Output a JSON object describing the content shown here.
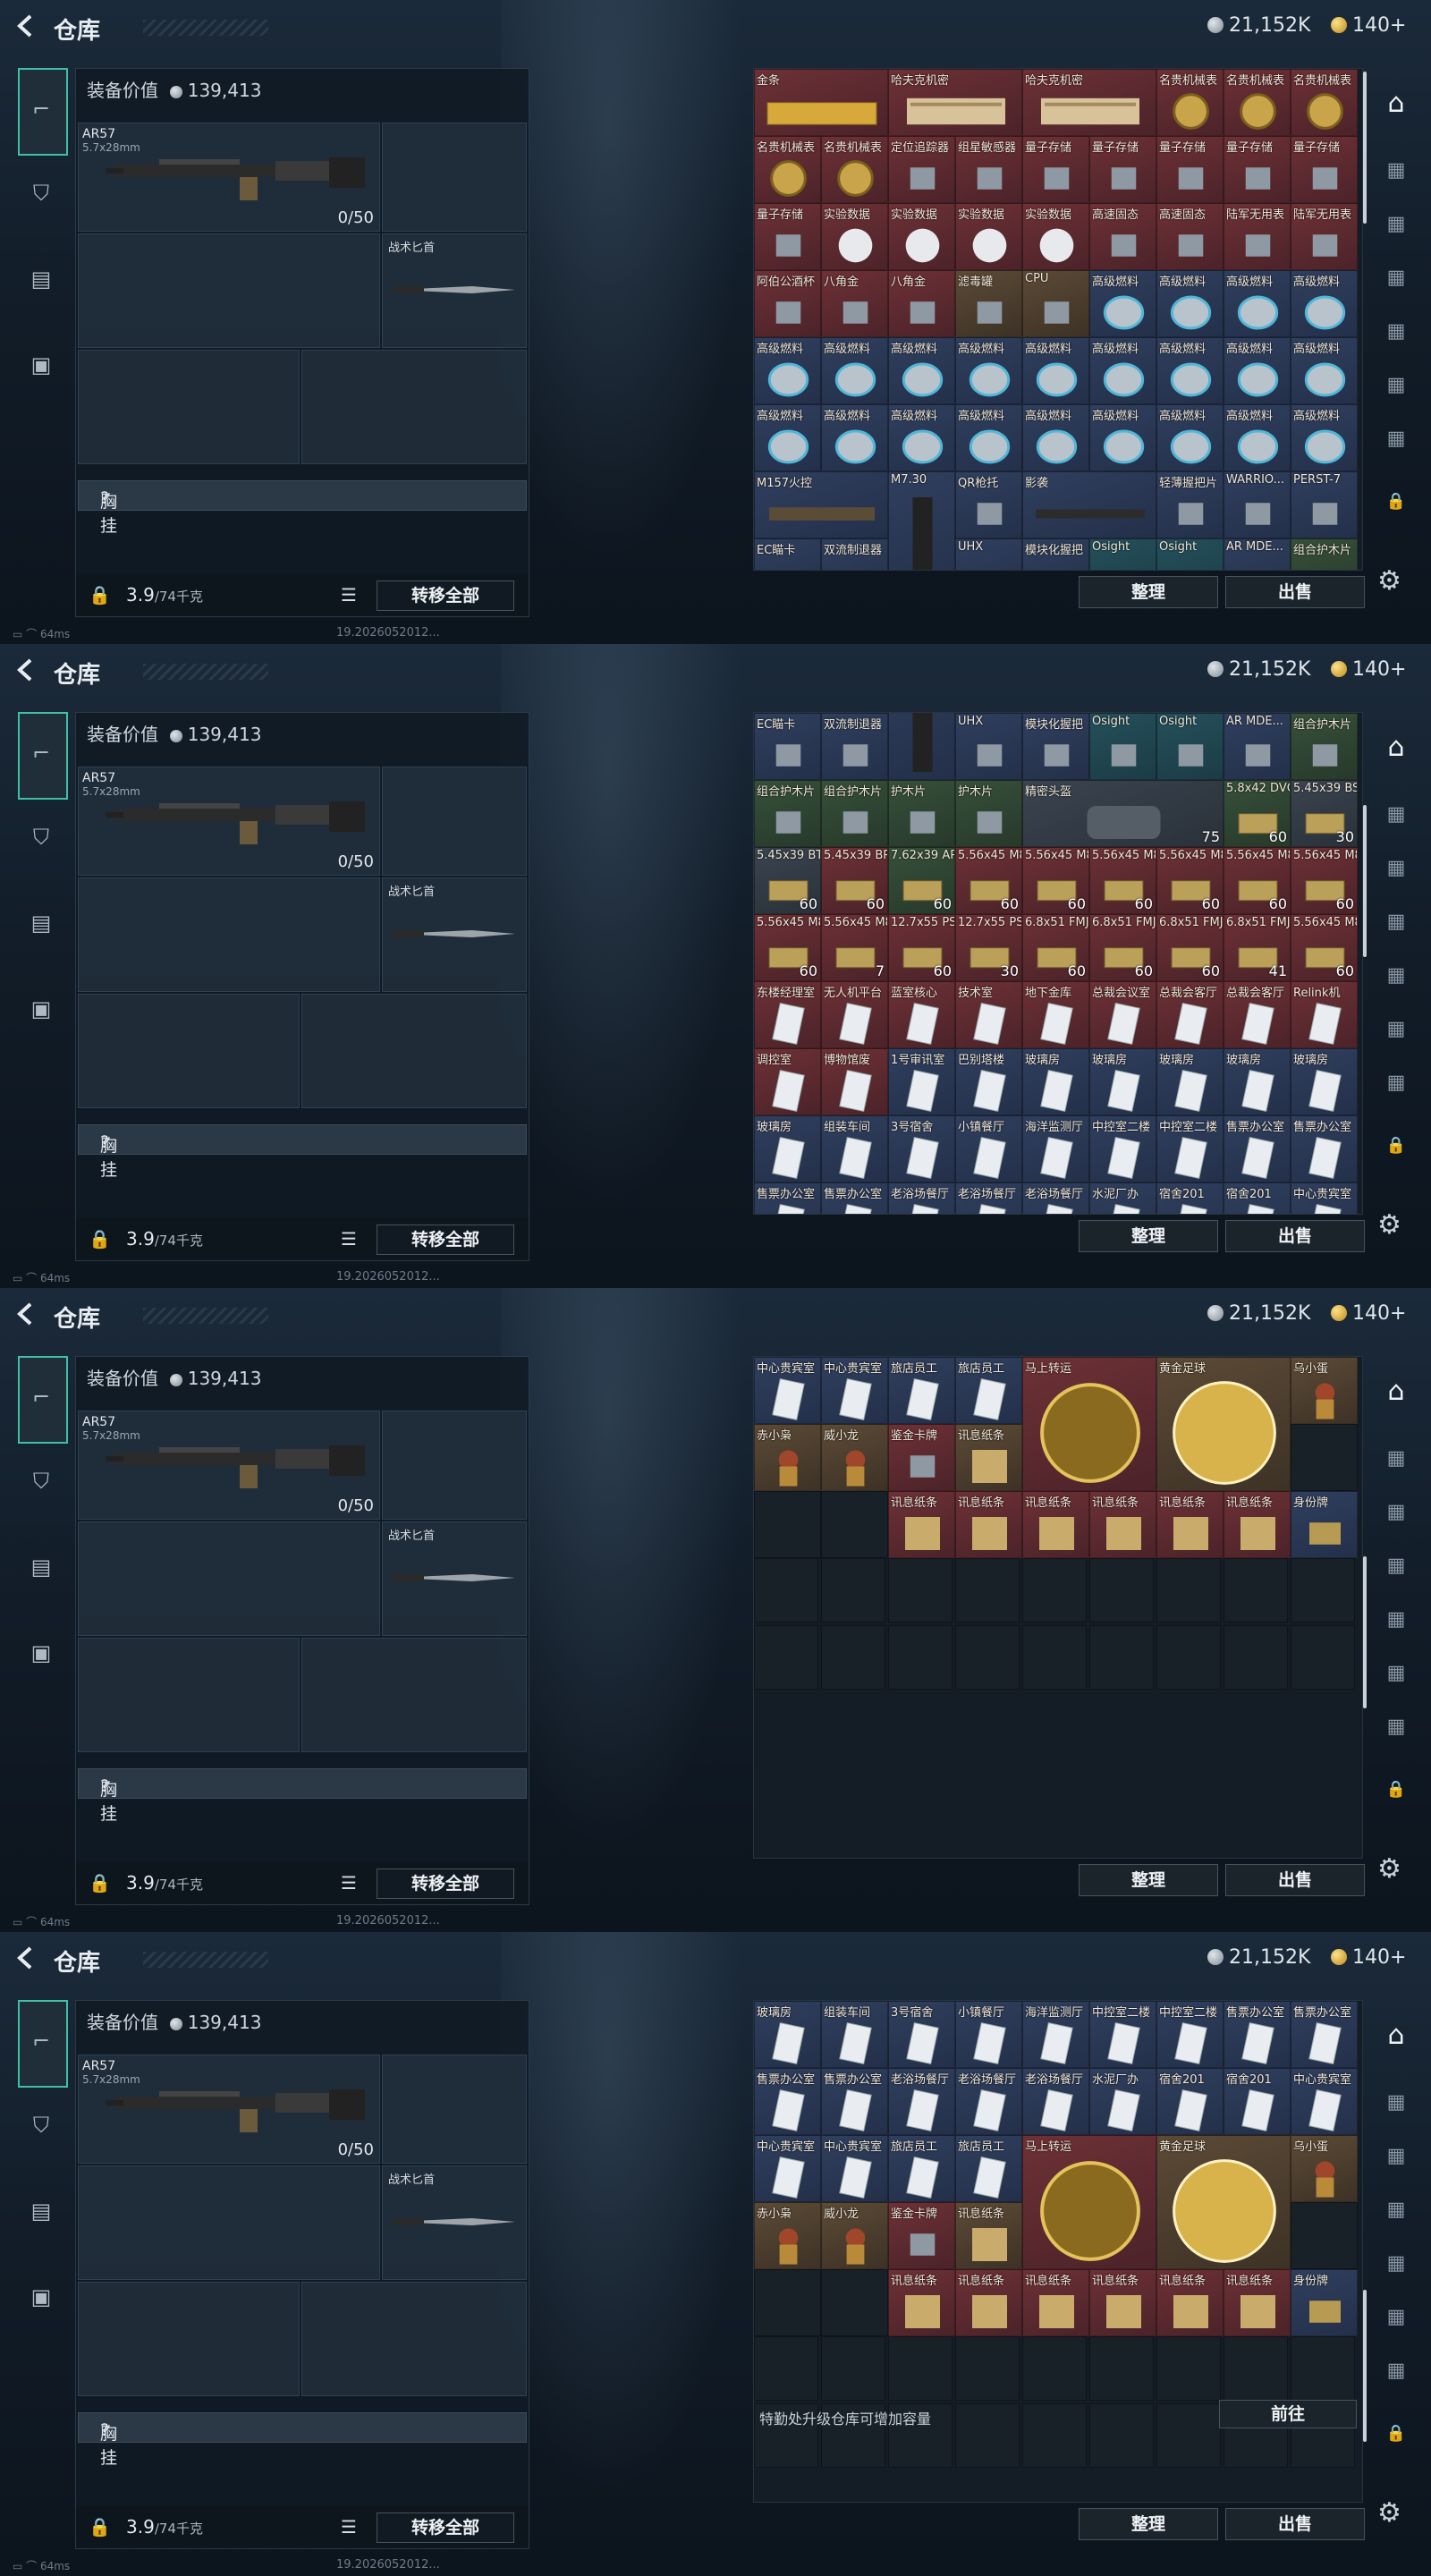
{
  "header": {
    "title": "仓库",
    "silver": "21,152K",
    "gold": "140+"
  },
  "equipment": {
    "value_label": "装备价值",
    "value": "139,413",
    "gun_name": "AR57",
    "gun_caliber": "5.7x28mm",
    "gun_ammo": "0/50",
    "knife_label": "战术匕首",
    "chest_label": "胸挂",
    "chest_help": "?",
    "weight": "3.9",
    "weight_max": "/74千克",
    "transfer_all": "转移全部"
  },
  "storage": {
    "sort": "整理",
    "sell": "出售",
    "upgrade_tip": "特勤处升级仓库可增加容量",
    "upgrade_go": "前往"
  },
  "status": {
    "ping": "64ms",
    "version": "19.2026052012..."
  },
  "colors": {
    "accent": "#3fbfa6",
    "rare_red": "#6d3136",
    "rare_blue": "#2f3f5e",
    "rare_gold": "#5c4a36"
  },
  "items": [
    {
      "n": "金条",
      "c": "red",
      "w": 2,
      "h": 1,
      "icon": "gold-bar-icon"
    },
    {
      "n": "哈夫克机密",
      "c": "red",
      "w": 2,
      "h": 1,
      "icon": "document-icon"
    },
    {
      "n": "哈夫克机密",
      "c": "red",
      "w": 2,
      "h": 1,
      "icon": "document-icon"
    },
    {
      "n": "名贵机械表",
      "c": "red",
      "icon": "watch-icon"
    },
    {
      "n": "名贵机械表",
      "c": "red",
      "icon": "watch-icon"
    },
    {
      "n": "名贵机械表",
      "c": "red",
      "icon": "watch-icon"
    },
    {
      "n": "名贵机械表",
      "c": "red",
      "icon": "watch-icon"
    },
    {
      "n": "名贵机械表",
      "c": "red",
      "icon": "watch-icon"
    },
    {
      "n": "定位追踪器",
      "c": "red",
      "icon": "device-icon"
    },
    {
      "n": "组星敏感器",
      "c": "red",
      "icon": "device-icon"
    },
    {
      "n": "量子存储",
      "c": "red",
      "icon": "chip-icon"
    },
    {
      "n": "量子存储",
      "c": "red",
      "icon": "chip-icon"
    },
    {
      "n": "量子存储",
      "c": "red",
      "icon": "chip-icon"
    },
    {
      "n": "量子存储",
      "c": "red",
      "icon": "chip-icon"
    },
    {
      "n": "量子存储",
      "c": "red",
      "icon": "chip-icon"
    },
    {
      "n": "量子存储",
      "c": "red",
      "icon": "chip-icon"
    },
    {
      "n": "实验数据",
      "c": "red",
      "icon": "disc-icon"
    },
    {
      "n": "实验数据",
      "c": "red",
      "icon": "disc-icon"
    },
    {
      "n": "实验数据",
      "c": "red",
      "icon": "disc-icon"
    },
    {
      "n": "实验数据",
      "c": "red",
      "icon": "disc-icon"
    },
    {
      "n": "高速固态",
      "c": "red",
      "icon": "ssd-icon"
    },
    {
      "n": "高速固态",
      "c": "red",
      "icon": "ssd-icon"
    },
    {
      "n": "陆军无用表",
      "c": "red",
      "icon": "box-icon"
    },
    {
      "n": "陆军无用表",
      "c": "red",
      "icon": "box-icon"
    },
    {
      "n": "阿伯公酒杯",
      "c": "red",
      "icon": "cup-icon"
    },
    {
      "n": "八角金",
      "c": "red",
      "icon": "coin-icon"
    },
    {
      "n": "八角金",
      "c": "red",
      "icon": "coin-icon"
    },
    {
      "n": "滤毒罐",
      "c": "gold",
      "icon": "canister-icon"
    },
    {
      "n": "CPU",
      "c": "gold",
      "icon": "cpu-icon"
    },
    {
      "n": "高级燃料",
      "c": "blue",
      "icon": "fuel-icon"
    },
    {
      "n": "高级燃料",
      "c": "blue",
      "icon": "fuel-icon"
    },
    {
      "n": "高级燃料",
      "c": "blue",
      "icon": "fuel-icon"
    },
    {
      "n": "高级燃料",
      "c": "blue",
      "icon": "fuel-icon"
    },
    {
      "n": "高级燃料",
      "c": "blue",
      "icon": "fuel-icon"
    },
    {
      "n": "高级燃料",
      "c": "blue",
      "icon": "fuel-icon"
    },
    {
      "n": "高级燃料",
      "c": "blue",
      "icon": "fuel-icon"
    },
    {
      "n": "高级燃料",
      "c": "blue",
      "icon": "fuel-icon"
    },
    {
      "n": "高级燃料",
      "c": "blue",
      "icon": "fuel-icon"
    },
    {
      "n": "高级燃料",
      "c": "blue",
      "icon": "fuel-icon"
    },
    {
      "n": "高级燃料",
      "c": "blue",
      "icon": "fuel-icon"
    },
    {
      "n": "高级燃料",
      "c": "blue",
      "icon": "fuel-icon"
    },
    {
      "n": "高级燃料",
      "c": "blue",
      "icon": "fuel-icon"
    },
    {
      "n": "高级燃料",
      "c": "blue",
      "icon": "fuel-icon"
    },
    {
      "n": "高级燃料",
      "c": "blue",
      "icon": "fuel-icon"
    },
    {
      "n": "高级燃料",
      "c": "blue",
      "icon": "fuel-icon"
    },
    {
      "n": "高级燃料",
      "c": "blue",
      "icon": "fuel-icon"
    },
    {
      "n": "高级燃料",
      "c": "blue",
      "icon": "fuel-icon"
    },
    {
      "n": "高级燃料",
      "c": "blue",
      "icon": "fuel-icon"
    },
    {
      "n": "高级燃料",
      "c": "blue",
      "icon": "fuel-icon"
    },
    {
      "n": "高级燃料",
      "c": "blue",
      "icon": "fuel-icon"
    },
    {
      "n": "高级燃料",
      "c": "blue",
      "icon": "fuel-icon"
    },
    {
      "n": "M157火控",
      "c": "blue",
      "w": 2,
      "h": 1,
      "icon": "scope-icon"
    },
    {
      "n": "M7.30",
      "c": "blue",
      "w": 1,
      "h": 2,
      "icon": "magazine-icon"
    },
    {
      "n": "QR枪托",
      "c": "blue",
      "icon": "stock-icon"
    },
    {
      "n": "影袭",
      "c": "blue",
      "w": 2,
      "h": 1,
      "icon": "rifle-icon"
    },
    {
      "n": "轻薄握把片",
      "c": "blue",
      "icon": "grip-icon"
    },
    {
      "n": "WARRIO...",
      "c": "blue",
      "icon": "grip-icon"
    },
    {
      "n": "PERST-7",
      "c": "blue",
      "icon": "laser-icon"
    },
    {
      "n": "EC瞄卡",
      "c": "blue",
      "icon": "sight-icon"
    },
    {
      "n": "双流制退器",
      "c": "blue",
      "icon": "muzzle-icon"
    },
    {
      "n": "UHX",
      "c": "blue",
      "icon": "sight-icon"
    },
    {
      "n": "模块化握把",
      "c": "blue",
      "icon": "grip-icon"
    },
    {
      "n": "Osight",
      "c": "teal",
      "icon": "sight-icon"
    },
    {
      "n": "Osight",
      "c": "teal",
      "icon": "sight-icon"
    },
    {
      "n": "AR MDE...",
      "c": "blue",
      "icon": "grip-icon"
    },
    {
      "n": "组合护木片",
      "c": "green",
      "icon": "rail-icon"
    },
    {
      "n": "组合护木片",
      "c": "green",
      "icon": "rail-icon"
    },
    {
      "n": "组合护木片",
      "c": "green",
      "icon": "rail-icon"
    },
    {
      "n": "护木片",
      "c": "green",
      "icon": "rail-icon"
    },
    {
      "n": "护木片",
      "c": "green",
      "icon": "rail-icon"
    },
    {
      "n": "精密头盔",
      "c": "grey",
      "w": 3,
      "h": 1,
      "icon": "helmet-icon",
      "q": "75"
    },
    {
      "n": "5.8x42 DVC12",
      "c": "green",
      "icon": "ammo-icon",
      "q": "60"
    },
    {
      "n": "5.45x39 BS",
      "c": "grey",
      "icon": "ammo-icon",
      "q": "30"
    },
    {
      "n": "5.45x39 BT",
      "c": "grey",
      "icon": "ammo-icon",
      "q": "60"
    },
    {
      "n": "5.45x39 BP",
      "c": "red",
      "icon": "ammo-icon",
      "q": "60"
    },
    {
      "n": "7.62x39 AP",
      "c": "green",
      "icon": "ammo-icon",
      "q": "60"
    },
    {
      "n": "5.56x45 M855",
      "c": "red",
      "icon": "ammo-icon",
      "q": "60"
    },
    {
      "n": "5.56x45 M855",
      "c": "red",
      "icon": "ammo-icon",
      "q": "60"
    },
    {
      "n": "5.56x45 M855",
      "c": "red",
      "icon": "ammo-icon",
      "q": "60"
    },
    {
      "n": "5.56x45 M855",
      "c": "red",
      "icon": "ammo-icon",
      "q": "60"
    },
    {
      "n": "5.56x45 M855",
      "c": "red",
      "icon": "ammo-icon",
      "q": "60"
    },
    {
      "n": "5.56x45 M855",
      "c": "red",
      "icon": "ammo-icon",
      "q": "60"
    },
    {
      "n": "5.56x45 M855",
      "c": "red",
      "icon": "ammo-icon",
      "q": "60"
    },
    {
      "n": "5.56x45 M855",
      "c": "red",
      "icon": "ammo-icon",
      "q": "7"
    },
    {
      "n": "12.7x55 PS12",
      "c": "red",
      "icon": "ammo-icon",
      "q": "60"
    },
    {
      "n": "12.7x55 PS12",
      "c": "red",
      "icon": "ammo-icon",
      "q": "30"
    },
    {
      "n": "6.8x51 FMJ",
      "c": "red",
      "icon": "ammo-icon",
      "q": "60"
    },
    {
      "n": "6.8x51 FMJ",
      "c": "red",
      "icon": "ammo-icon",
      "q": "60"
    },
    {
      "n": "6.8x51 FMJ",
      "c": "red",
      "icon": "ammo-icon",
      "q": "60"
    },
    {
      "n": "6.8x51 FMJ",
      "c": "red",
      "icon": "ammo-icon",
      "q": "41"
    },
    {
      "n": "5.56x45 M855A1",
      "c": "red",
      "icon": "ammo-icon",
      "q": "60"
    },
    {
      "n": "东楼经理室",
      "c": "red",
      "icon": "keycard-icon"
    },
    {
      "n": "无人机平台",
      "c": "red",
      "icon": "keycard-icon"
    },
    {
      "n": "蓝室核心",
      "c": "red",
      "icon": "keycard-icon"
    },
    {
      "n": "技术室",
      "c": "red",
      "icon": "keycard-icon"
    },
    {
      "n": "地下金库",
      "c": "red",
      "icon": "keycard-icon"
    },
    {
      "n": "总裁会议室",
      "c": "red",
      "icon": "keycard-icon"
    },
    {
      "n": "总裁会客厅",
      "c": "red",
      "icon": "keycard-icon"
    },
    {
      "n": "总裁会客厅",
      "c": "red",
      "icon": "keycard-icon"
    },
    {
      "n": "Relink机",
      "c": "red",
      "icon": "keycard-icon"
    },
    {
      "n": "调控室",
      "c": "red",
      "icon": "keycard-icon"
    },
    {
      "n": "博物馆废",
      "c": "red",
      "icon": "keycard-icon"
    },
    {
      "n": "1号审讯室",
      "c": "blue",
      "icon": "keycard-icon"
    },
    {
      "n": "巴别塔楼",
      "c": "blue",
      "icon": "keycard-icon"
    },
    {
      "n": "玻璃房",
      "c": "blue",
      "icon": "keycard-icon"
    },
    {
      "n": "玻璃房",
      "c": "blue",
      "icon": "keycard-icon"
    },
    {
      "n": "玻璃房",
      "c": "blue",
      "icon": "keycard-icon"
    },
    {
      "n": "玻璃房",
      "c": "blue",
      "icon": "keycard-icon"
    },
    {
      "n": "玻璃房",
      "c": "blue",
      "icon": "keycard-icon"
    },
    {
      "n": "玻璃房",
      "c": "blue",
      "icon": "keycard-icon"
    },
    {
      "n": "组装车间",
      "c": "blue",
      "icon": "keycard-icon"
    },
    {
      "n": "3号宿舍",
      "c": "blue",
      "icon": "keycard-icon"
    },
    {
      "n": "小镇餐厅",
      "c": "blue",
      "icon": "keycard-icon"
    },
    {
      "n": "海洋监测厅",
      "c": "blue",
      "icon": "keycard-icon"
    },
    {
      "n": "中控室二楼",
      "c": "blue",
      "icon": "keycard-icon"
    },
    {
      "n": "中控室二楼",
      "c": "blue",
      "icon": "keycard-icon"
    },
    {
      "n": "售票办公室",
      "c": "blue",
      "icon": "keycard-icon"
    },
    {
      "n": "售票办公室",
      "c": "blue",
      "icon": "keycard-icon"
    },
    {
      "n": "售票办公室",
      "c": "blue",
      "icon": "keycard-icon"
    },
    {
      "n": "售票办公室",
      "c": "blue",
      "icon": "keycard-icon"
    },
    {
      "n": "老浴场餐厅",
      "c": "blue",
      "icon": "keycard-icon"
    },
    {
      "n": "老浴场餐厅",
      "c": "blue",
      "icon": "keycard-icon"
    },
    {
      "n": "老浴场餐厅",
      "c": "blue",
      "icon": "keycard-icon"
    },
    {
      "n": "水泥厂办",
      "c": "blue",
      "icon": "keycard-icon"
    },
    {
      "n": "宿舍201",
      "c": "blue",
      "icon": "keycard-icon"
    },
    {
      "n": "宿舍201",
      "c": "blue",
      "icon": "keycard-icon"
    },
    {
      "n": "中心贵宾室",
      "c": "blue",
      "icon": "keycard-icon"
    },
    {
      "n": "中心贵宾室",
      "c": "blue",
      "icon": "keycard-icon"
    },
    {
      "n": "中心贵宾室",
      "c": "blue",
      "icon": "keycard-icon"
    },
    {
      "n": "旅店员工",
      "c": "blue",
      "icon": "keycard-icon"
    },
    {
      "n": "旅店员工",
      "c": "blue",
      "icon": "keycard-icon"
    },
    {
      "n": "马上转运",
      "c": "red",
      "w": 2,
      "h": 2,
      "icon": "roulette-icon"
    },
    {
      "n": "黄金足球",
      "c": "gold",
      "w": 2,
      "h": 2,
      "icon": "football-icon"
    },
    {
      "n": "乌小蛋",
      "c": "gold",
      "icon": "figure-icon"
    },
    {
      "n": "赤小枭",
      "c": "gold",
      "icon": "figure-icon"
    },
    {
      "n": "威小龙",
      "c": "gold",
      "icon": "figure-icon"
    },
    {
      "n": "鉴金卡牌",
      "c": "red",
      "icon": "card-icon"
    },
    {
      "n": "讯息纸条",
      "c": "gold",
      "icon": "note-icon"
    },
    {
      "n": "",
      "c": "empty",
      "icon": ""
    },
    {
      "n": "",
      "c": "empty",
      "icon": ""
    },
    {
      "n": "",
      "c": "empty",
      "icon": ""
    },
    {
      "n": "讯息纸条",
      "c": "red",
      "icon": "note-icon"
    },
    {
      "n": "讯息纸条",
      "c": "red",
      "icon": "note-icon"
    },
    {
      "n": "讯息纸条",
      "c": "red",
      "icon": "note-icon"
    },
    {
      "n": "讯息纸条",
      "c": "red",
      "icon": "note-icon"
    },
    {
      "n": "讯息纸条",
      "c": "red",
      "icon": "note-icon"
    },
    {
      "n": "讯息纸条",
      "c": "red",
      "icon": "note-icon"
    },
    {
      "n": "身份牌",
      "c": "blue",
      "icon": "tag-icon"
    }
  ]
}
